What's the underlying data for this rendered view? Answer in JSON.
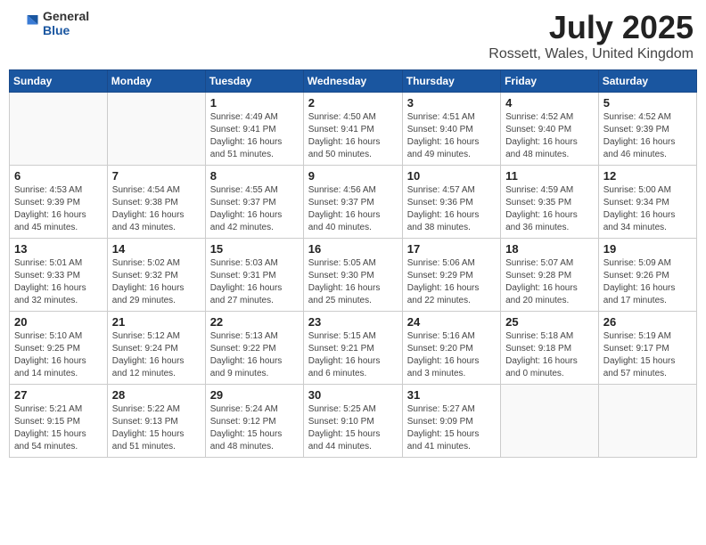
{
  "logo": {
    "general": "General",
    "blue": "Blue"
  },
  "header": {
    "month_year": "July 2025",
    "location": "Rossett, Wales, United Kingdom"
  },
  "weekdays": [
    "Sunday",
    "Monday",
    "Tuesday",
    "Wednesday",
    "Thursday",
    "Friday",
    "Saturday"
  ],
  "weeks": [
    [
      null,
      null,
      {
        "day": 1,
        "sunrise": "4:49 AM",
        "sunset": "9:41 PM",
        "daylight": "16 hours and 51 minutes."
      },
      {
        "day": 2,
        "sunrise": "4:50 AM",
        "sunset": "9:41 PM",
        "daylight": "16 hours and 50 minutes."
      },
      {
        "day": 3,
        "sunrise": "4:51 AM",
        "sunset": "9:40 PM",
        "daylight": "16 hours and 49 minutes."
      },
      {
        "day": 4,
        "sunrise": "4:52 AM",
        "sunset": "9:40 PM",
        "daylight": "16 hours and 48 minutes."
      },
      {
        "day": 5,
        "sunrise": "4:52 AM",
        "sunset": "9:39 PM",
        "daylight": "16 hours and 46 minutes."
      }
    ],
    [
      {
        "day": 6,
        "sunrise": "4:53 AM",
        "sunset": "9:39 PM",
        "daylight": "16 hours and 45 minutes."
      },
      {
        "day": 7,
        "sunrise": "4:54 AM",
        "sunset": "9:38 PM",
        "daylight": "16 hours and 43 minutes."
      },
      {
        "day": 8,
        "sunrise": "4:55 AM",
        "sunset": "9:37 PM",
        "daylight": "16 hours and 42 minutes."
      },
      {
        "day": 9,
        "sunrise": "4:56 AM",
        "sunset": "9:37 PM",
        "daylight": "16 hours and 40 minutes."
      },
      {
        "day": 10,
        "sunrise": "4:57 AM",
        "sunset": "9:36 PM",
        "daylight": "16 hours and 38 minutes."
      },
      {
        "day": 11,
        "sunrise": "4:59 AM",
        "sunset": "9:35 PM",
        "daylight": "16 hours and 36 minutes."
      },
      {
        "day": 12,
        "sunrise": "5:00 AM",
        "sunset": "9:34 PM",
        "daylight": "16 hours and 34 minutes."
      }
    ],
    [
      {
        "day": 13,
        "sunrise": "5:01 AM",
        "sunset": "9:33 PM",
        "daylight": "16 hours and 32 minutes."
      },
      {
        "day": 14,
        "sunrise": "5:02 AM",
        "sunset": "9:32 PM",
        "daylight": "16 hours and 29 minutes."
      },
      {
        "day": 15,
        "sunrise": "5:03 AM",
        "sunset": "9:31 PM",
        "daylight": "16 hours and 27 minutes."
      },
      {
        "day": 16,
        "sunrise": "5:05 AM",
        "sunset": "9:30 PM",
        "daylight": "16 hours and 25 minutes."
      },
      {
        "day": 17,
        "sunrise": "5:06 AM",
        "sunset": "9:29 PM",
        "daylight": "16 hours and 22 minutes."
      },
      {
        "day": 18,
        "sunrise": "5:07 AM",
        "sunset": "9:28 PM",
        "daylight": "16 hours and 20 minutes."
      },
      {
        "day": 19,
        "sunrise": "5:09 AM",
        "sunset": "9:26 PM",
        "daylight": "16 hours and 17 minutes."
      }
    ],
    [
      {
        "day": 20,
        "sunrise": "5:10 AM",
        "sunset": "9:25 PM",
        "daylight": "16 hours and 14 minutes."
      },
      {
        "day": 21,
        "sunrise": "5:12 AM",
        "sunset": "9:24 PM",
        "daylight": "16 hours and 12 minutes."
      },
      {
        "day": 22,
        "sunrise": "5:13 AM",
        "sunset": "9:22 PM",
        "daylight": "16 hours and 9 minutes."
      },
      {
        "day": 23,
        "sunrise": "5:15 AM",
        "sunset": "9:21 PM",
        "daylight": "16 hours and 6 minutes."
      },
      {
        "day": 24,
        "sunrise": "5:16 AM",
        "sunset": "9:20 PM",
        "daylight": "16 hours and 3 minutes."
      },
      {
        "day": 25,
        "sunrise": "5:18 AM",
        "sunset": "9:18 PM",
        "daylight": "16 hours and 0 minutes."
      },
      {
        "day": 26,
        "sunrise": "5:19 AM",
        "sunset": "9:17 PM",
        "daylight": "15 hours and 57 minutes."
      }
    ],
    [
      {
        "day": 27,
        "sunrise": "5:21 AM",
        "sunset": "9:15 PM",
        "daylight": "15 hours and 54 minutes."
      },
      {
        "day": 28,
        "sunrise": "5:22 AM",
        "sunset": "9:13 PM",
        "daylight": "15 hours and 51 minutes."
      },
      {
        "day": 29,
        "sunrise": "5:24 AM",
        "sunset": "9:12 PM",
        "daylight": "15 hours and 48 minutes."
      },
      {
        "day": 30,
        "sunrise": "5:25 AM",
        "sunset": "9:10 PM",
        "daylight": "15 hours and 44 minutes."
      },
      {
        "day": 31,
        "sunrise": "5:27 AM",
        "sunset": "9:09 PM",
        "daylight": "15 hours and 41 minutes."
      },
      null,
      null
    ]
  ]
}
